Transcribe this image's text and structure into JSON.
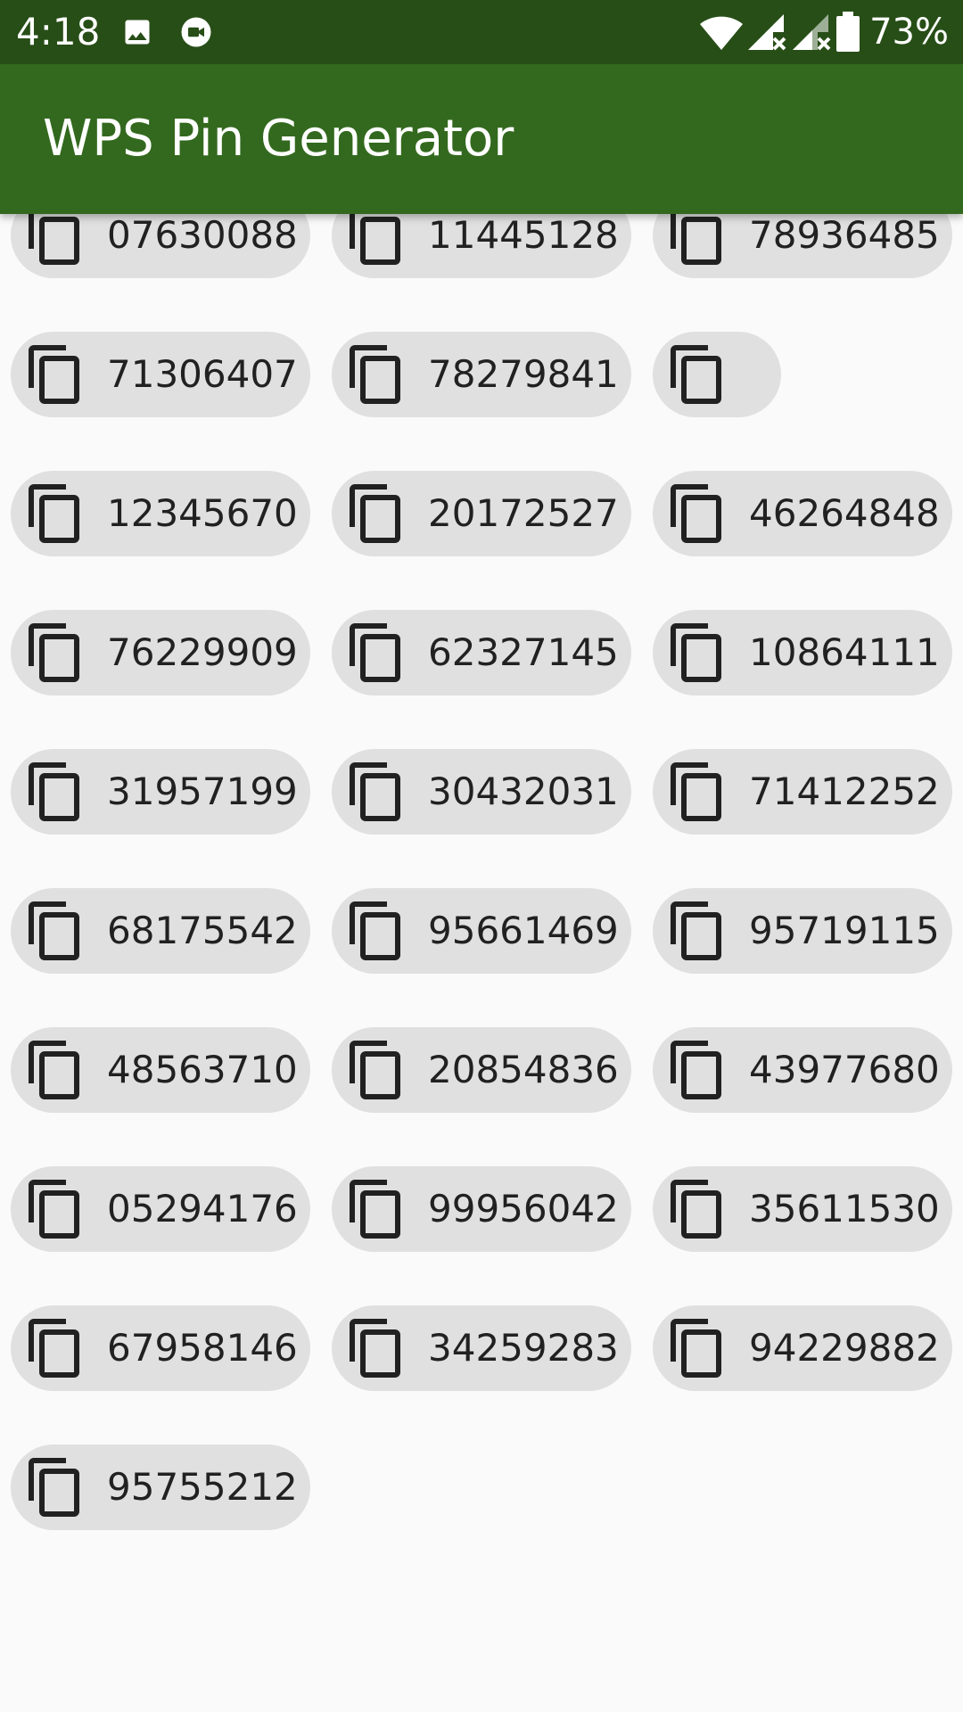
{
  "status_bar": {
    "time": "4:18",
    "battery": "73%",
    "left_icons": [
      "image-icon",
      "video-call-icon"
    ],
    "right_icons": [
      "wifi-icon",
      "signal-no-data-icon",
      "signal-no-data-icon",
      "battery-icon"
    ]
  },
  "app_bar": {
    "title": "WPS Pin Generator"
  },
  "colors": {
    "status_bar": "#274e17",
    "app_bar": "#33691e",
    "chip_background": "#e0e0e0",
    "chip_text": "#212121",
    "page_background": "#fafafa"
  },
  "pins": [
    [
      "07630088",
      "11445128",
      "78936485"
    ],
    [
      "71306407",
      "78279841",
      ""
    ],
    [
      "12345670",
      "20172527",
      "46264848"
    ],
    [
      "76229909",
      "62327145",
      "10864111"
    ],
    [
      "31957199",
      "30432031",
      "71412252"
    ],
    [
      "68175542",
      "95661469",
      "95719115"
    ],
    [
      "48563710",
      "20854836",
      "43977680"
    ],
    [
      "05294176",
      "99956042",
      "35611530"
    ],
    [
      "67958146",
      "34259283",
      "94229882"
    ],
    [
      "95755212"
    ]
  ],
  "chip_icon": "copy-icon"
}
